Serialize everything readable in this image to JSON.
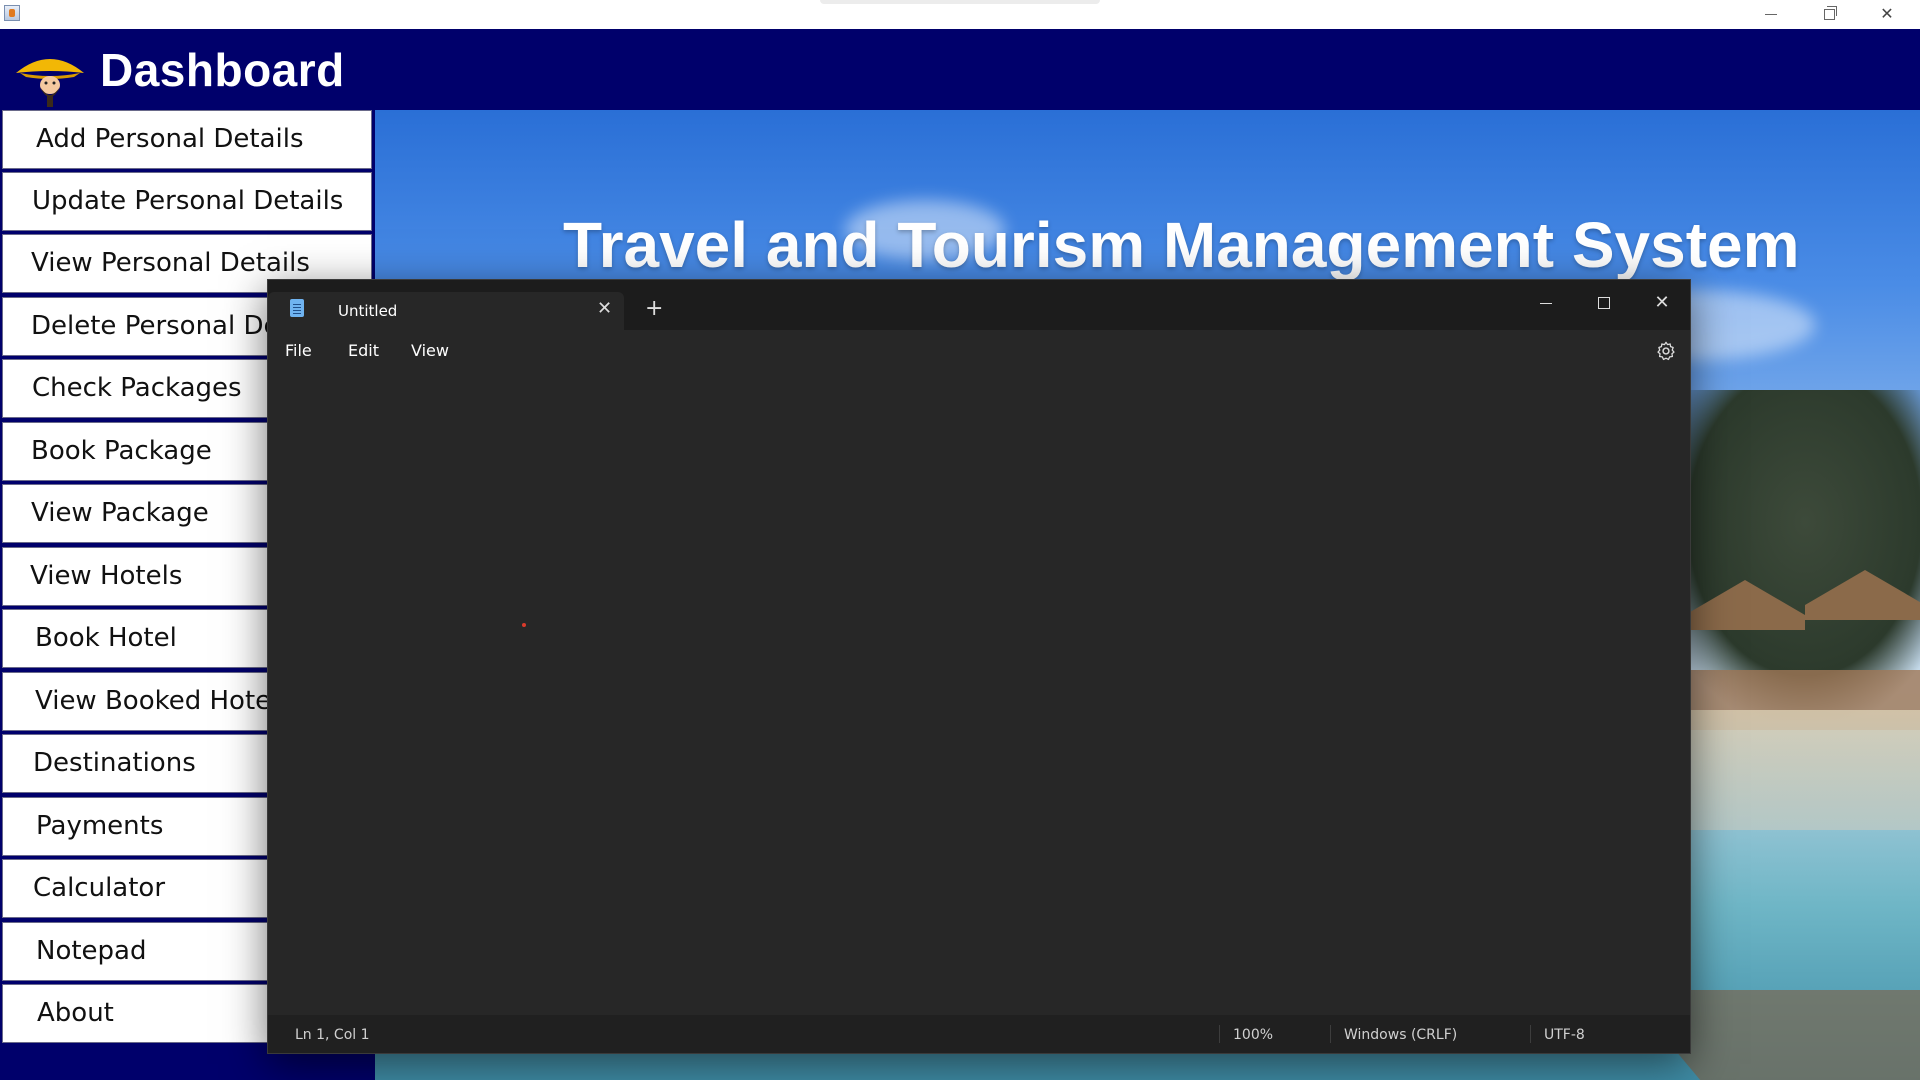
{
  "window": {
    "title_icon": "java-app-icon"
  },
  "dashboard": {
    "title": "Dashboard",
    "logo": "hat-man-logo-icon"
  },
  "sidebar": {
    "items": [
      {
        "label": "Add Personal Details"
      },
      {
        "label": "Update Personal Details"
      },
      {
        "label": "View Personal Details"
      },
      {
        "label": "Delete Personal Details"
      },
      {
        "label": "Check Packages"
      },
      {
        "label": "Book Package"
      },
      {
        "label": "View Package"
      },
      {
        "label": "View Hotels"
      },
      {
        "label": "Book Hotel"
      },
      {
        "label": "View Booked Hotel"
      },
      {
        "label": "Destinations"
      },
      {
        "label": "Payments"
      },
      {
        "label": "Calculator"
      },
      {
        "label": "Notepad"
      },
      {
        "label": "About"
      }
    ]
  },
  "banner": {
    "title": "Travel and Tourism Management System"
  },
  "notepad": {
    "tab_title": "Untitled",
    "tab_close": "✕",
    "new_tab": "+",
    "menu": {
      "file": "File",
      "edit": "Edit",
      "view": "View"
    },
    "status": {
      "position": "Ln 1, Col 1",
      "zoom": "100%",
      "line_ending": "Windows (CRLF)",
      "encoding": "UTF-8"
    }
  },
  "colors": {
    "dashboard_bg": "#00006b",
    "notepad_bg": "#272727",
    "notepad_status_bg": "#202020"
  }
}
